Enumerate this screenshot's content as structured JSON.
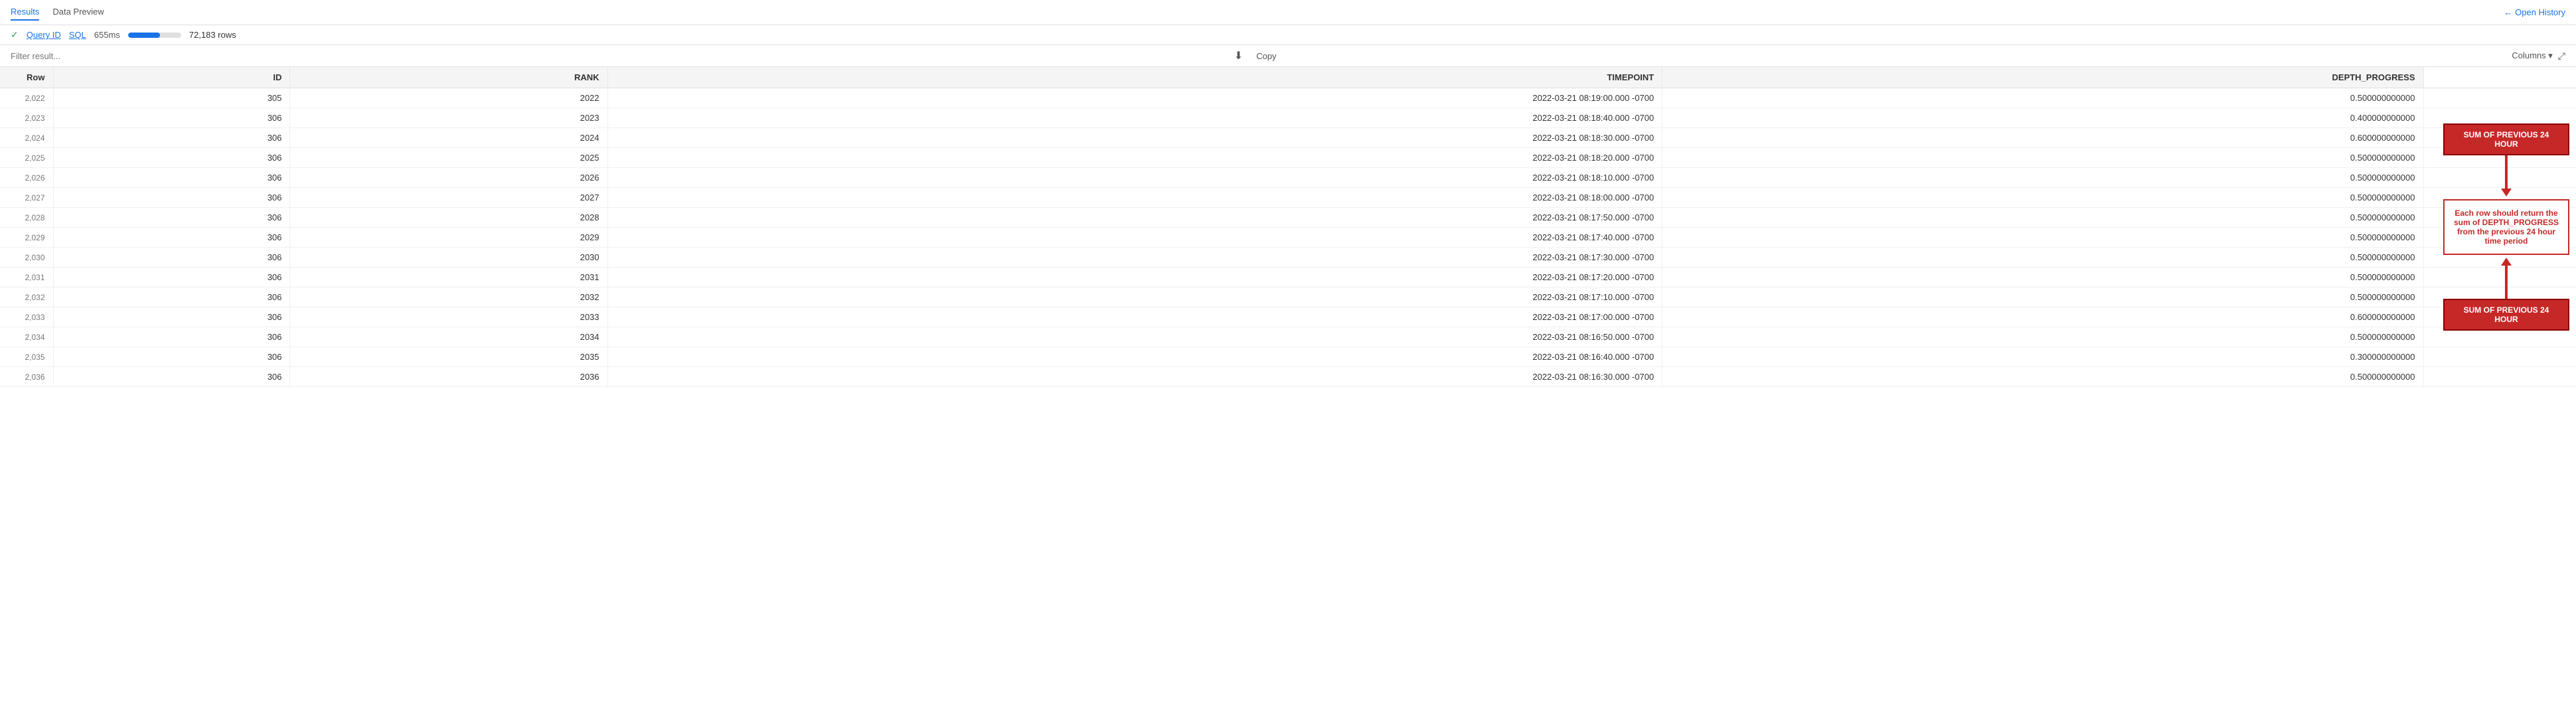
{
  "tabs": [
    {
      "label": "Results",
      "active": true
    },
    {
      "label": "Data Preview",
      "active": false
    }
  ],
  "open_history": "← Open History",
  "query_info": {
    "check": "✓",
    "query_id_label": "Query ID",
    "sql_label": "SQL",
    "duration": "655ms",
    "progress_percent": 60,
    "row_count": "72,183 rows"
  },
  "filter": {
    "placeholder": "Filter result..."
  },
  "toolbar": {
    "download_icon": "⬇",
    "copy_label": "Copy",
    "columns_label": "Columns ▾",
    "expand_icon": "⛶"
  },
  "table": {
    "columns": [
      "Row",
      "ID",
      "RANK",
      "TIMEPOINT",
      "DEPTH_PROGRESS"
    ],
    "rows": [
      {
        "row": "2,022",
        "id": "305",
        "rank": "2022",
        "timepoint": "2022-03-21 08:19:00.000 -0700",
        "depth_progress": "0.500000000000"
      },
      {
        "row": "2,023",
        "id": "306",
        "rank": "2023",
        "timepoint": "2022-03-21 08:18:40.000 -0700",
        "depth_progress": "0.400000000000"
      },
      {
        "row": "2,024",
        "id": "306",
        "rank": "2024",
        "timepoint": "2022-03-21 08:18:30.000 -0700",
        "depth_progress": "0.600000000000"
      },
      {
        "row": "2,025",
        "id": "306",
        "rank": "2025",
        "timepoint": "2022-03-21 08:18:20.000 -0700",
        "depth_progress": "0.500000000000"
      },
      {
        "row": "2,026",
        "id": "306",
        "rank": "2026",
        "timepoint": "2022-03-21 08:18:10.000 -0700",
        "depth_progress": "0.500000000000"
      },
      {
        "row": "2,027",
        "id": "306",
        "rank": "2027",
        "timepoint": "2022-03-21 08:18:00.000 -0700",
        "depth_progress": "0.500000000000"
      },
      {
        "row": "2,028",
        "id": "306",
        "rank": "2028",
        "timepoint": "2022-03-21 08:17:50.000 -0700",
        "depth_progress": "0.500000000000"
      },
      {
        "row": "2,029",
        "id": "306",
        "rank": "2029",
        "timepoint": "2022-03-21 08:17:40.000 -0700",
        "depth_progress": "0.500000000000"
      },
      {
        "row": "2,030",
        "id": "306",
        "rank": "2030",
        "timepoint": "2022-03-21 08:17:30.000 -0700",
        "depth_progress": "0.500000000000"
      },
      {
        "row": "2,031",
        "id": "306",
        "rank": "2031",
        "timepoint": "2022-03-21 08:17:20.000 -0700",
        "depth_progress": "0.500000000000"
      },
      {
        "row": "2,032",
        "id": "306",
        "rank": "2032",
        "timepoint": "2022-03-21 08:17:10.000 -0700",
        "depth_progress": "0.500000000000"
      },
      {
        "row": "2,033",
        "id": "306",
        "rank": "2033",
        "timepoint": "2022-03-21 08:17:00.000 -0700",
        "depth_progress": "0.600000000000"
      },
      {
        "row": "2,034",
        "id": "306",
        "rank": "2034",
        "timepoint": "2022-03-21 08:16:50.000 -0700",
        "depth_progress": "0.500000000000"
      },
      {
        "row": "2,035",
        "id": "306",
        "rank": "2035",
        "timepoint": "2022-03-21 08:16:40.000 -0700",
        "depth_progress": "0.300000000000"
      },
      {
        "row": "2,036",
        "id": "306",
        "rank": "2036",
        "timepoint": "2022-03-21 08:16:30.000 -0700",
        "depth_progress": "0.500000000000"
      }
    ]
  },
  "annotations": {
    "top_label": "SUM OF PREVIOUS 24 HOUR",
    "center_label": "Each row should return the sum of DEPTH_PROGRESS from the previous 24 hour time period",
    "bottom_label": "SUM OF PREVIOUS 24 HOUR"
  }
}
